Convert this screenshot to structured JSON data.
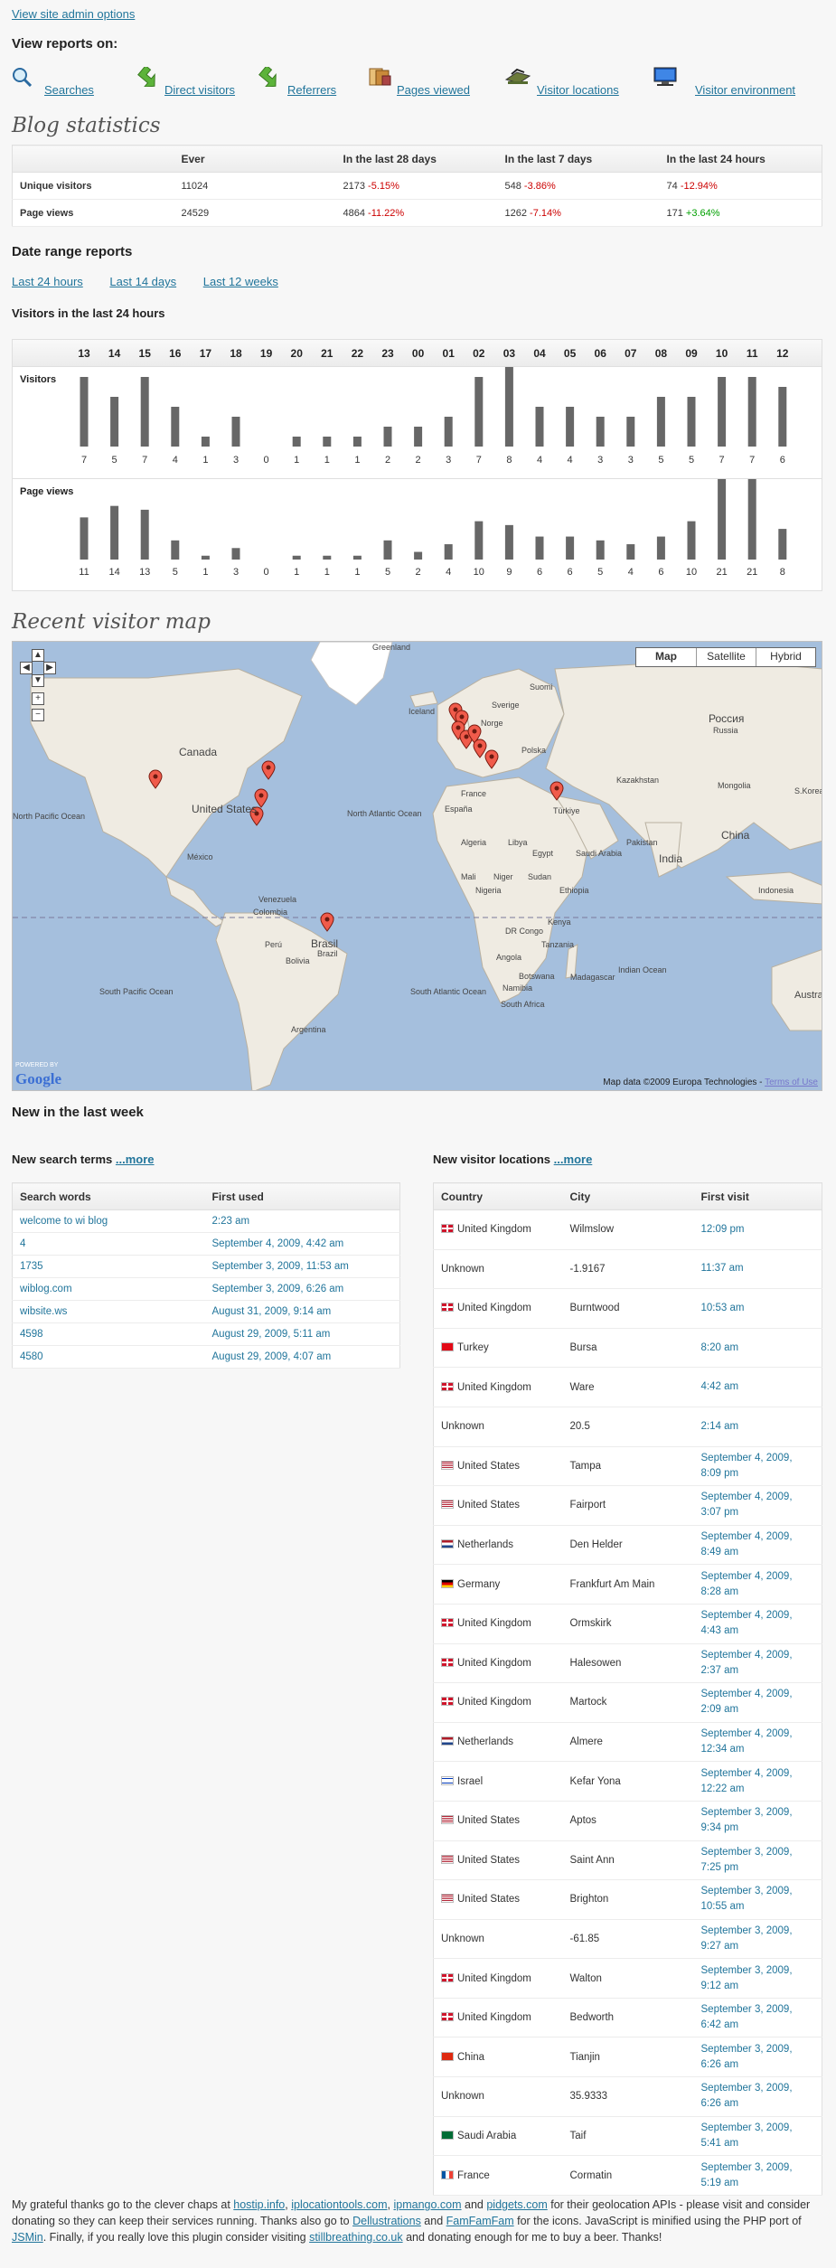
{
  "admin_link": "View site admin options",
  "view_heading": "View reports on:",
  "reports": [
    {
      "label": "Searches",
      "icon": "magnifier-icon"
    },
    {
      "label": "Direct visitors",
      "icon": "green-arrow-icon"
    },
    {
      "label": "Referrers",
      "icon": "green-arrow-icon"
    },
    {
      "label": "Pages viewed",
      "icon": "pages-icon"
    },
    {
      "label": "Visitor locations",
      "icon": "globe-icon"
    },
    {
      "label": "Visitor environment",
      "icon": "monitor-icon"
    }
  ],
  "blog_stats": {
    "title": "Blog statistics",
    "headers": [
      "",
      "Ever",
      "In the last 28 days",
      "In the last 7 days",
      "In the last 24 hours"
    ],
    "rows": [
      {
        "label": "Unique visitors",
        "ever": "11024",
        "d28": "2173",
        "d28c": "-5.15%",
        "d7": "548",
        "d7c": "-3.86%",
        "h24": "74",
        "h24c": "-12.94%"
      },
      {
        "label": "Page views",
        "ever": "24529",
        "d28": "4864",
        "d28c": "-11.22%",
        "d7": "1262",
        "d7c": "-7.14%",
        "h24": "171",
        "h24c": "+3.64%"
      }
    ]
  },
  "date_range": {
    "title": "Date range reports",
    "links": [
      "Last 24 hours",
      "Last 14 days",
      "Last 12 weeks"
    ]
  },
  "chart_heading": "Visitors in the last 24 hours",
  "chart_data": {
    "type": "bar",
    "categories": [
      "13",
      "14",
      "15",
      "16",
      "17",
      "18",
      "19",
      "20",
      "21",
      "22",
      "23",
      "00",
      "01",
      "02",
      "03",
      "04",
      "05",
      "06",
      "07",
      "08",
      "09",
      "10",
      "11",
      "12"
    ],
    "series": [
      {
        "name": "Visitors",
        "values": [
          7,
          5,
          7,
          4,
          1,
          3,
          0,
          1,
          1,
          1,
          2,
          2,
          3,
          7,
          8,
          4,
          4,
          3,
          3,
          5,
          5,
          7,
          7,
          6
        ]
      },
      {
        "name": "Page views",
        "values": [
          11,
          14,
          13,
          5,
          1,
          3,
          0,
          1,
          1,
          1,
          5,
          2,
          4,
          10,
          9,
          6,
          6,
          5,
          4,
          6,
          10,
          21,
          21,
          8
        ]
      }
    ],
    "colors": {
      "bar": "#676767"
    }
  },
  "map": {
    "title": "Recent visitor map",
    "types": [
      "Map",
      "Satellite",
      "Hybrid"
    ],
    "labels": [
      {
        "text": "Greenland"
      },
      {
        "text": "Iceland"
      },
      {
        "text": "Sverige"
      },
      {
        "text": "Suomi"
      },
      {
        "text": "Norge"
      },
      {
        "text": "Россия"
      },
      {
        "text": "Russia"
      },
      {
        "text": "Canada"
      },
      {
        "text": "Polska"
      },
      {
        "text": "Kazakhstan"
      },
      {
        "text": "Mongolia"
      },
      {
        "text": "France"
      },
      {
        "text": "España"
      },
      {
        "text": "Türkiye"
      },
      {
        "text": "China"
      },
      {
        "text": "United States"
      },
      {
        "text": "North Pacific Ocean"
      },
      {
        "text": "North Atlantic Ocean"
      },
      {
        "text": "Algeria"
      },
      {
        "text": "Libya"
      },
      {
        "text": "Egypt"
      },
      {
        "text": "Saudi Arabia"
      },
      {
        "text": "Pakistan"
      },
      {
        "text": "India"
      },
      {
        "text": "México"
      },
      {
        "text": "Mali"
      },
      {
        "text": "Niger"
      },
      {
        "text": "Sudan"
      },
      {
        "text": "Nigeria"
      },
      {
        "text": "Ethiopia"
      },
      {
        "text": "Venezuela"
      },
      {
        "text": "Colombia"
      },
      {
        "text": "DR Congo"
      },
      {
        "text": "Kenya"
      },
      {
        "text": "Tanzania"
      },
      {
        "text": "Brasil"
      },
      {
        "text": "Brazil"
      },
      {
        "text": "Perú"
      },
      {
        "text": "Bolivia"
      },
      {
        "text": "Angola"
      },
      {
        "text": "Namibia"
      },
      {
        "text": "Botswana"
      },
      {
        "text": "Madagascar"
      },
      {
        "text": "Indian Ocean"
      },
      {
        "text": "South Pacific Ocean"
      },
      {
        "text": "South Atlantic Ocean"
      },
      {
        "text": "Argentina"
      },
      {
        "text": "South Africa"
      },
      {
        "text": "Indonesia"
      },
      {
        "text": "Austra"
      },
      {
        "text": "S.Korea"
      }
    ],
    "powered": "POWERED BY",
    "google": "Google",
    "attribution": "Map data ©2009 Europa Technologies - ",
    "terms": "Terms of Use"
  },
  "new_week": {
    "title": "New in the last week",
    "search_title": "New search terms",
    "search_more": "...more",
    "search_headers": [
      "Search words",
      "First used"
    ],
    "search_rows": [
      [
        "welcome to wi blog",
        "2:23 am"
      ],
      [
        "4",
        "September 4, 2009, 4:42 am"
      ],
      [
        "1735",
        "September 3, 2009, 11:53 am"
      ],
      [
        "wiblog.com",
        "September 3, 2009, 6:26 am"
      ],
      [
        "wibsite.ws",
        "August 31, 2009, 9:14 am"
      ],
      [
        "4598",
        "August 29, 2009, 5:11 am"
      ],
      [
        "4580",
        "August 29, 2009, 4:07 am"
      ]
    ],
    "loc_title": "New visitor locations",
    "loc_more": "...more",
    "loc_headers": [
      "Country",
      "City",
      "First visit"
    ],
    "loc_rows": [
      {
        "flag": "gb",
        "country": "United Kingdom",
        "city": "Wilmslow",
        "first": "12:09 pm"
      },
      {
        "flag": "",
        "country": "Unknown",
        "city": "-1.9167",
        "first": "11:37 am"
      },
      {
        "flag": "gb",
        "country": "United Kingdom",
        "city": "Burntwood",
        "first": "10:53 am"
      },
      {
        "flag": "tr",
        "country": "Turkey",
        "city": "Bursa",
        "first": "8:20 am"
      },
      {
        "flag": "gb",
        "country": "United Kingdom",
        "city": "Ware",
        "first": "4:42 am"
      },
      {
        "flag": "",
        "country": "Unknown",
        "city": "20.5",
        "first": "2:14 am"
      },
      {
        "flag": "us",
        "country": "United States",
        "city": "Tampa",
        "first": "September 4, 2009, 8:09 pm"
      },
      {
        "flag": "us",
        "country": "United States",
        "city": "Fairport",
        "first": "September 4, 2009, 3:07 pm"
      },
      {
        "flag": "nl",
        "country": "Netherlands",
        "city": "Den Helder",
        "first": "September 4, 2009, 8:49 am"
      },
      {
        "flag": "de",
        "country": "Germany",
        "city": "Frankfurt Am Main",
        "first": "September 4, 2009, 8:28 am"
      },
      {
        "flag": "gb",
        "country": "United Kingdom",
        "city": "Ormskirk",
        "first": "September 4, 2009, 4:43 am"
      },
      {
        "flag": "gb",
        "country": "United Kingdom",
        "city": "Halesowen",
        "first": "September 4, 2009, 2:37 am"
      },
      {
        "flag": "gb",
        "country": "United Kingdom",
        "city": "Martock",
        "first": "September 4, 2009, 2:09 am"
      },
      {
        "flag": "nl",
        "country": "Netherlands",
        "city": "Almere",
        "first": "September 4, 2009, 12:34 am"
      },
      {
        "flag": "il",
        "country": "Israel",
        "city": "Kefar Yona",
        "first": "September 4, 2009, 12:22 am"
      },
      {
        "flag": "us",
        "country": "United States",
        "city": "Aptos",
        "first": "September 3, 2009, 9:34 pm"
      },
      {
        "flag": "us",
        "country": "United States",
        "city": "Saint Ann",
        "first": "September 3, 2009, 7:25 pm"
      },
      {
        "flag": "us",
        "country": "United States",
        "city": "Brighton",
        "first": "September 3, 2009, 10:55 am"
      },
      {
        "flag": "",
        "country": "Unknown",
        "city": "-61.85",
        "first": "September 3, 2009, 9:27 am"
      },
      {
        "flag": "gb",
        "country": "United Kingdom",
        "city": "Walton",
        "first": "September 3, 2009, 9:12 am"
      },
      {
        "flag": "gb",
        "country": "United Kingdom",
        "city": "Bedworth",
        "first": "September 3, 2009, 6:42 am"
      },
      {
        "flag": "cn",
        "country": "China",
        "city": "Tianjin",
        "first": "September 3, 2009, 6:26 am"
      },
      {
        "flag": "",
        "country": "Unknown",
        "city": "35.9333",
        "first": "September 3, 2009, 6:26 am"
      },
      {
        "flag": "sa",
        "country": "Saudi Arabia",
        "city": "Taif",
        "first": "September 3, 2009, 5:41 am"
      },
      {
        "flag": "fr",
        "country": "France",
        "city": "Cormatin",
        "first": "September 3, 2009, 5:19 am"
      }
    ]
  },
  "footer": {
    "t1": "My grateful thanks go to the clever chaps at ",
    "l1": "hostip.info",
    "t2": ", ",
    "l2": "iplocationtools.com",
    "t3": ", ",
    "l3": "ipmango.com",
    "t4": " and ",
    "l4": "pidgets.com",
    "t5": " for their geolocation APIs - please visit and consider donating so they can keep their services running. Thanks also go to ",
    "l5": "Dellustrations",
    "t6": " and ",
    "l6": "FamFamFam",
    "t7": " for the icons. JavaScript is minified using the PHP port of ",
    "l7": "JSMin",
    "t8": ". Finally, if you really love this plugin consider visiting ",
    "l8": "stillbreathing.co.uk",
    "t9": " and donating enough for me to buy a beer. Thanks!"
  }
}
